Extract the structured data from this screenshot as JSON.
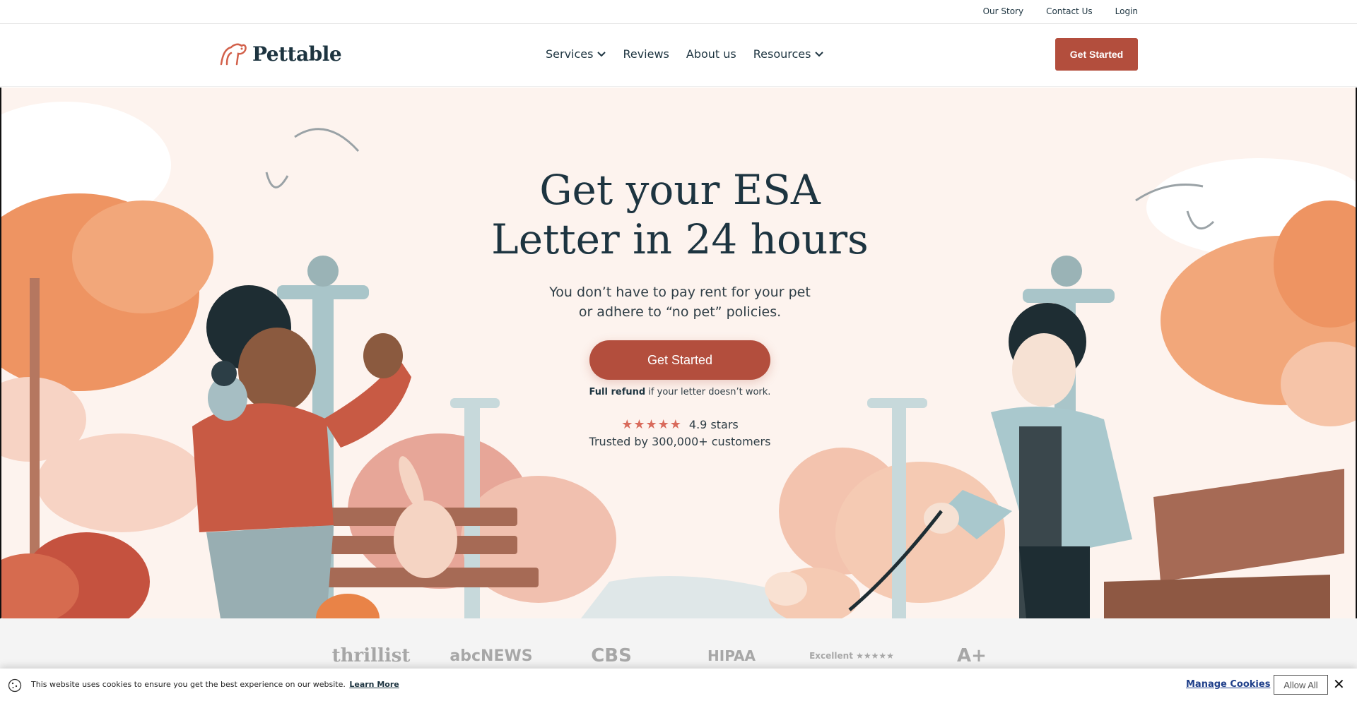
{
  "utility": {
    "our_story": "Our Story",
    "contact": "Contact Us",
    "login": "Login"
  },
  "nav": {
    "logo_text": "Pettable",
    "items": [
      {
        "label": "Services",
        "has_dropdown": true
      },
      {
        "label": "Reviews",
        "has_dropdown": false
      },
      {
        "label": "About us",
        "has_dropdown": false
      },
      {
        "label": "Resources",
        "has_dropdown": true
      }
    ],
    "cta": "Get Started"
  },
  "hero": {
    "title_line1": "Get your ESA",
    "title_line2": "Letter in 24 hours",
    "sub_line1": "You don’t have to pay rent for your pet",
    "sub_line2": "or adhere to “no pet” policies.",
    "cta": "Get Started",
    "refund_bold": "Full refund",
    "refund_rest": " if your letter doesn’t work.",
    "stars": "★★★★★",
    "rating": "4.9 stars",
    "trusted": "Trusted by 300,000+ customers"
  },
  "press": {
    "logos": [
      "thrillist",
      "abcNEWS",
      "CBS",
      "HIPAA",
      "Excellent ★★★★★",
      "A+"
    ]
  },
  "cookie": {
    "text": "This website uses cookies to ensure you get the best experience on our website.",
    "learn_more": "Learn More",
    "manage": "Manage Cookies",
    "allow": "Allow All",
    "close": "✕"
  },
  "colors": {
    "brand": "#b34e3d",
    "navy": "#1d3440",
    "hero_bg": "#fdf3ee"
  }
}
